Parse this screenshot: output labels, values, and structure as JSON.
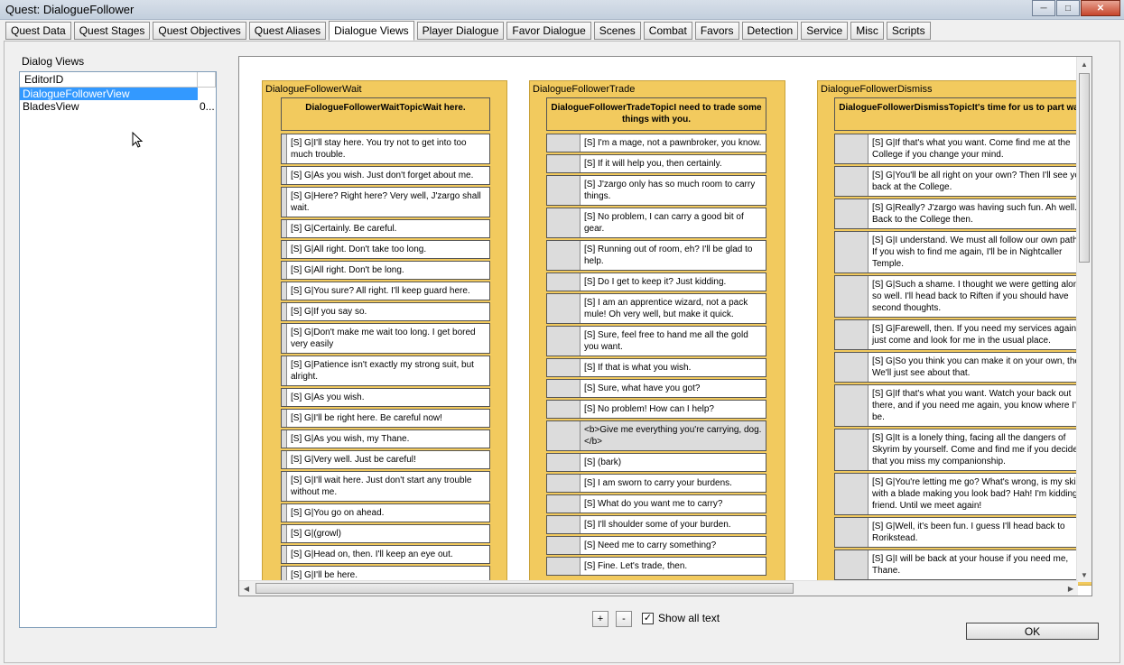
{
  "window": {
    "title": "Quest: DialogueFollower",
    "minimize": "─",
    "maximize": "□",
    "close": "✕"
  },
  "tabs": [
    {
      "label": "Quest Data"
    },
    {
      "label": "Quest Stages"
    },
    {
      "label": "Quest Objectives"
    },
    {
      "label": "Quest Aliases"
    },
    {
      "label": "Dialogue Views",
      "active": true
    },
    {
      "label": "Player Dialogue"
    },
    {
      "label": "Favor Dialogue"
    },
    {
      "label": "Scenes"
    },
    {
      "label": "Combat"
    },
    {
      "label": "Favors"
    },
    {
      "label": "Detection"
    },
    {
      "label": "Service"
    },
    {
      "label": "Misc"
    },
    {
      "label": "Scripts"
    }
  ],
  "dialog_views": {
    "label": "Dialog Views",
    "column_header": "EditorID",
    "rows": [
      {
        "name": "DialogueFollowerView",
        "extra": "",
        "selected": true
      },
      {
        "name": "BladesView",
        "extra": "0..."
      }
    ]
  },
  "views": [
    {
      "title": "DialogueFollowerWait",
      "topic_name": "DialogueFollowerWaitTopic",
      "topic_text": "Wait here.",
      "lines": [
        "[S] G|I'll stay here. You try not to get into too much trouble.",
        "[S] G|As you wish. Just don't forget about me.",
        "[S] G|Here? Right here? Very well, J'zargo shall wait.",
        "[S] G|Certainly. Be careful.",
        "[S] G|All right. Don't take too long.",
        "[S] G|All right. Don't be long.",
        "[S] G|You sure? All right. I'll keep guard here.",
        "[S] G|If you say so.",
        "[S] G|Don't make me wait too long. I get bored very easily",
        "[S] G|Patience isn't exactly my strong suit, but alright.",
        "[S] G|As you wish.",
        "[S] G|I'll be right here. Be careful now!",
        "[S] G|As you wish, my Thane.",
        "[S] G|Very well. Just be careful!",
        "[S] G|I'll wait here. Just don't start any trouble without me.",
        "[S] G|You go on ahead.",
        "[S] G|(growl)",
        "[S] G|Head on, then. I'll keep an eye out.",
        "[S] G|I'll be here."
      ]
    },
    {
      "title": "DialogueFollowerTrade",
      "topic_name": "DialogueFollowerTradeTopic",
      "topic_text": "I need to trade some things with you.",
      "lines": [
        "[S] I'm a mage, not a pawnbroker, you know.",
        "[S] If it will help you, then certainly.",
        "[S] J'zargo only has so much room to carry things.",
        "[S] No problem, I can carry a good bit of gear.",
        "[S] Running out of room, eh? I'll be glad to help.",
        "[S] Do I get to keep it? Just kidding.",
        "[S] I am an apprentice wizard, not a pack mule! Oh very well, but make it quick.",
        "[S] Sure, feel free to hand me all the gold you want.",
        "[S] If that is what you wish.",
        "[S] Sure, what have you got?",
        "[S] No problem! How can I help?",
        "<b>Give me everything you're carrying, dog.</b>",
        "[S] (bark)",
        "[S] I am sworn to carry your burdens.",
        "[S] What do you want me to carry?",
        "[S] I'll shoulder some of your burden.",
        "[S] Need me to carry something?",
        "[S] Fine. Let's trade, then."
      ]
    },
    {
      "title": "DialogueFollowerDismiss",
      "topic_name": "DialogueFollowerDismissTopic",
      "topic_text": "It's time for us to part ways.",
      "lines": [
        "[S] G|If that's what you want. Come find me at the College if you change your mind.",
        "[S] G|You'll be all right on your own? Then I'll see you back at the College.",
        "[S] G|Really? J'zargo was having such fun. Ah well. Back to the College then.",
        "[S] G|I understand. We must all follow our own paths. If you wish to find me again, I'll be in Nightcaller Temple.",
        "[S] G|Such a shame. I thought we were getting along so well. I'll head back to Riften if you should have second thoughts.",
        "[S] G|Farewell, then. If you need my services again, just come and look for me in the usual place.",
        "[S] G|So you think you can make it on your own, then? We'll just see about that.",
        "[S] G|If that's what you want. Watch your back out there, and if you need me again, you know where I'll be.",
        "[S] G|It is a lonely thing, facing all the dangers of Skyrim by yourself. Come and find me if you decide that you miss my companionship.",
        "[S] G|You're letting me go? What's wrong, is my skill with a blade making you look bad? Hah! I'm kidding, friend. Until we meet again!",
        "[S] G|Well, it's been fun. I guess I'll head back to Rorikstead.",
        "[S] G|I will be back at your house if you need me, Thane."
      ]
    }
  ],
  "controls": {
    "zoom_in": "+",
    "zoom_out": "-",
    "show_all_text_label": "Show all text",
    "show_all_text_checked": true,
    "ok_label": "OK"
  }
}
